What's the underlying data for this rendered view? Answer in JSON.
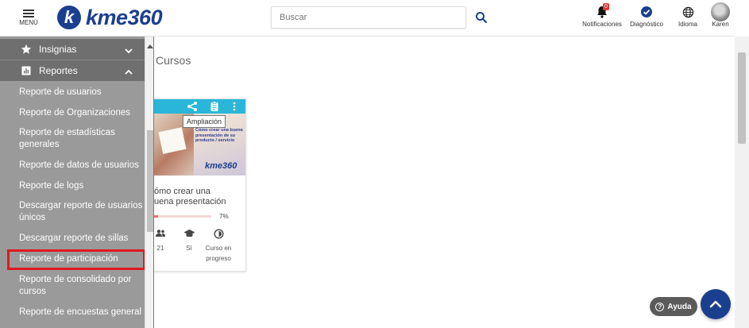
{
  "header": {
    "menu_label": "MENÚ",
    "logo_letter": "k",
    "logo_text": "kme360",
    "search_placeholder": "Buscar",
    "notifications_label": "Notificaciones",
    "notifications_count": "0",
    "diagnostic_label": "Diagnóstico",
    "language_label": "Idioma",
    "user_label": "Karen"
  },
  "page": {
    "title": "Cursos"
  },
  "course_card": {
    "tooltip": "Ampliación",
    "image_text": "Cómo crear una buena presentación de su producto / servicio",
    "image_logo": "kme360",
    "title": "ómo crear una\nuena presentación",
    "progress": 7,
    "progress_label": "7%",
    "stats": [
      {
        "icon": "group-icon",
        "value": "21"
      },
      {
        "icon": "graduation-cap-icon",
        "value": "Sí"
      },
      {
        "icon": "progress-circle-icon",
        "value": "Curso en progreso"
      }
    ],
    "toolbar_color": "#29b6d8"
  },
  "sidebar": {
    "sections": [
      {
        "label": "Insignias",
        "icon": "star-icon",
        "expanded": false
      },
      {
        "label": "Reportes",
        "icon": "bar-chart-icon",
        "expanded": true
      }
    ],
    "items": [
      {
        "label": "Reporte de usuarios"
      },
      {
        "label": "Reporte de Organizaciones"
      },
      {
        "label": "Reporte de estadísticas generales"
      },
      {
        "label": "Reporte de datos de usuarios"
      },
      {
        "label": "Reporte de logs"
      },
      {
        "label": "Descargar reporte de usuarios únicos"
      },
      {
        "label": "Descargar reporte de sillas"
      },
      {
        "label": "Reporte de participación"
      },
      {
        "label": "Reporte de consolidado por cursos"
      },
      {
        "label": "Reporte de encuestas general"
      }
    ],
    "highlighted_item": "Reporte de participación",
    "highlight_color": "#e0191f"
  },
  "help": {
    "label": "Ayuda"
  },
  "colors": {
    "brand": "#1b3f8f",
    "sidebar_bg": "#9a9a9a",
    "section_bg": "#6f6f6f"
  }
}
